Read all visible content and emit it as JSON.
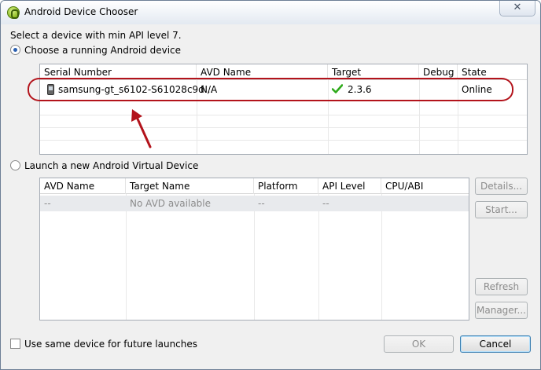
{
  "window": {
    "title": "Android Device Chooser",
    "close_glyph": "✕"
  },
  "prompt": "Select a device with min API level 7.",
  "running_option": {
    "label": "Choose a running Android device",
    "selected": true
  },
  "device_table": {
    "columns": [
      "Serial Number",
      "AVD Name",
      "Target",
      "Debug",
      "State"
    ],
    "rows": [
      {
        "serial": "samsung-gt_s6102-S61028c9d...",
        "avd": "N/A",
        "target": "2.3.6",
        "debug": "",
        "state": "Online"
      }
    ]
  },
  "launch_option": {
    "label": "Launch a new Android Virtual Device",
    "selected": false
  },
  "avd_table": {
    "columns": [
      "AVD Name",
      "Target Name",
      "Platform",
      "API Level",
      "CPU/ABI"
    ],
    "rows": [
      {
        "avd": "--",
        "target": "No AVD available",
        "platform": "--",
        "api": "--",
        "cpu": ""
      }
    ]
  },
  "side_buttons": {
    "details": "Details...",
    "start": "Start...",
    "refresh": "Refresh",
    "manager": "Manager..."
  },
  "footer": {
    "same_device_label": "Use same device for future launches",
    "ok": "OK",
    "cancel": "Cancel"
  },
  "colors": {
    "annotation": "#b3131b",
    "check": "#2faa1c"
  }
}
